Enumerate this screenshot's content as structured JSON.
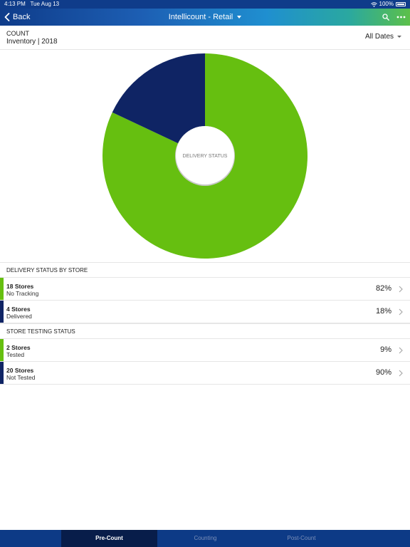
{
  "status_bar": {
    "time": "4:13 PM",
    "date": "Tue Aug 13",
    "battery": "100%"
  },
  "nav": {
    "back_label": "Back",
    "title": "Intellicount - Retail"
  },
  "header": {
    "count_label": "COUNT",
    "count_value": "Inventory | 2018",
    "date_filter": "All Dates"
  },
  "colors": {
    "green": "#66bf10",
    "navy": "#0f2464"
  },
  "chart_data": {
    "type": "pie",
    "center_label": "DELIVERY STATUS",
    "categories": [
      "No Tracking",
      "Delivered"
    ],
    "values": [
      82,
      18
    ],
    "colors": [
      "#66bf10",
      "#0f2464"
    ]
  },
  "delivery": {
    "section_title": "DELIVERY STATUS BY STORE",
    "rows": [
      {
        "count": "18 Stores",
        "label": "No Tracking",
        "percent": "82%",
        "color": "#66bf10"
      },
      {
        "count": "4 Stores",
        "label": "Delivered",
        "percent": "18%",
        "color": "#0f2464"
      }
    ]
  },
  "testing": {
    "section_title": "STORE TESTING STATUS",
    "rows": [
      {
        "count": "2 Stores",
        "label": "Tested",
        "percent": "9%",
        "color": "#66bf10"
      },
      {
        "count": "20 Stores",
        "label": "Not Tested",
        "percent": "90%",
        "color": "#0f2464"
      }
    ]
  },
  "tabs": [
    {
      "label": "Pre-Count",
      "active": true
    },
    {
      "label": "Counting",
      "active": false
    },
    {
      "label": "Post-Count",
      "active": false
    }
  ]
}
